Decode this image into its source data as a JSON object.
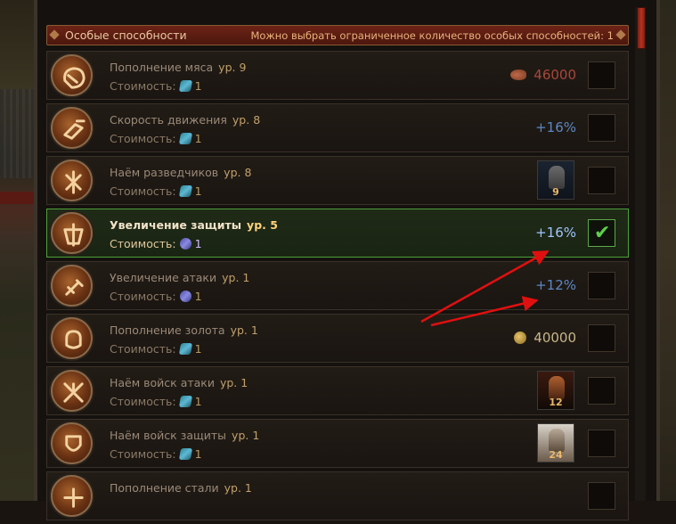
{
  "header": {
    "title": "Особые способности",
    "info": "Можно выбрать ограниченное количество особых способностей: 1"
  },
  "cost_label": "Стоимость:",
  "level_prefix": "ур.",
  "rows": [
    {
      "name": "Пополнение мяса",
      "level": "9",
      "cost": "1",
      "value": "46000",
      "value_type": "meat",
      "icon": "meat-ability-icon",
      "selected": false
    },
    {
      "name": "Скорость движения",
      "level": "8",
      "cost": "1",
      "value": "+16%",
      "value_type": "blue",
      "icon": "speed-ability-icon",
      "selected": false
    },
    {
      "name": "Наём разведчиков",
      "level": "8",
      "cost": "1",
      "value": "9",
      "value_type": "unit",
      "icon": "scout-hire-ability-icon",
      "selected": false
    },
    {
      "name": "Увеличение защиты",
      "level": "5",
      "cost": "1",
      "value": "+16%",
      "value_type": "blue",
      "icon": "defense-ability-icon",
      "selected": true
    },
    {
      "name": "Увеличение атаки",
      "level": "1",
      "cost": "1",
      "value": "+12%",
      "value_type": "blue",
      "icon": "attack-ability-icon",
      "selected": false
    },
    {
      "name": "Пополнение золота",
      "level": "1",
      "cost": "1",
      "value": "40000",
      "value_type": "gold",
      "icon": "gold-ability-icon",
      "selected": false
    },
    {
      "name": "Наём войск атаки",
      "level": "1",
      "cost": "1",
      "value": "12",
      "value_type": "unit",
      "icon": "attack-troops-ability-icon",
      "selected": false
    },
    {
      "name": "Наём войск защиты",
      "level": "1",
      "cost": "1",
      "value": "24",
      "value_type": "unit",
      "icon": "defense-troops-ability-icon",
      "selected": false
    },
    {
      "name": "Пополнение стали",
      "level": "1",
      "cost": "",
      "value": "",
      "value_type": "none",
      "icon": "steel-ability-icon",
      "selected": false
    }
  ],
  "colors": {
    "header_bg": "#5a1c10",
    "selected_border": "#4fa13a",
    "arrow": "#e01010"
  }
}
